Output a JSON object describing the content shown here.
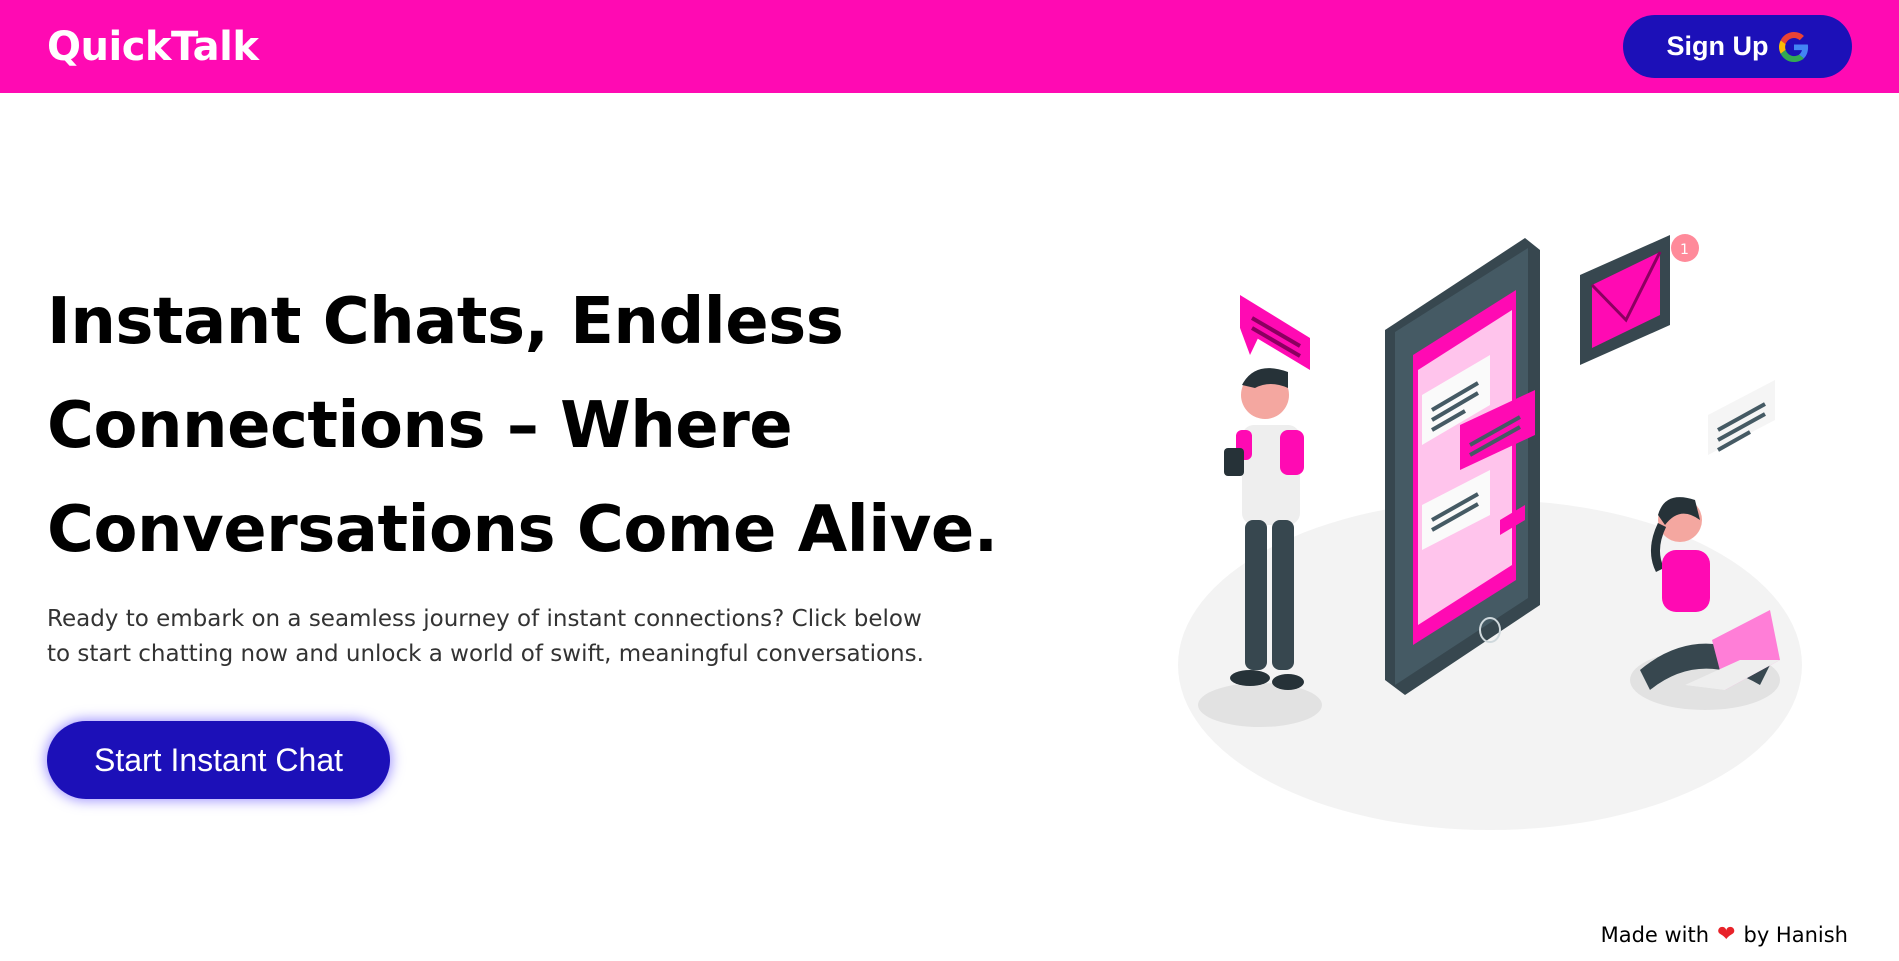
{
  "navbar": {
    "brand": "QuickTalk",
    "signup_label": "Sign Up",
    "signup_icon": "google-g-icon",
    "bg_color": "#ff0ab3",
    "button_color": "#1c10b8"
  },
  "hero": {
    "title_lines": [
      "Instant Chats, Endless",
      "Connections – Where",
      "Conversations Come Alive."
    ],
    "subtitle_lines": [
      "Ready to embark on a seamless journey of instant connections? Click below",
      "to start chatting now and unlock a world of swift, meaningful conversations."
    ],
    "cta_label": "Start Instant Chat"
  },
  "footer": {
    "made_with": "Made with",
    "heart_icon": "heart-icon",
    "by": "by Hanish"
  }
}
